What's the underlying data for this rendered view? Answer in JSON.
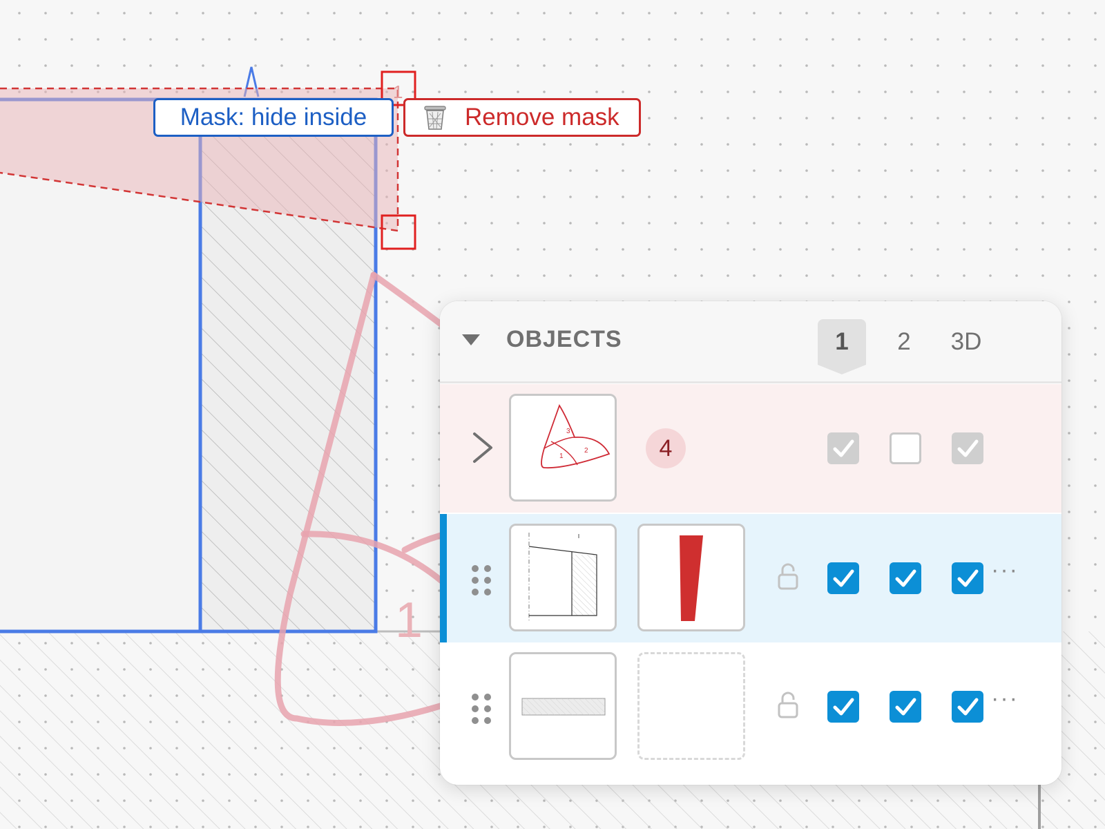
{
  "canvas": {
    "dimension_label": "1",
    "handle_label": "1"
  },
  "mask_toolbar": {
    "mask_mode_label": "Mask: hide inside",
    "remove_label": "Remove mask"
  },
  "panel": {
    "title": "OBJECTS",
    "view_tabs": [
      {
        "label": "1",
        "active": true
      },
      {
        "label": "2",
        "active": false
      },
      {
        "label": "3D",
        "active": false
      }
    ],
    "rows": [
      {
        "type": "group",
        "badge": "4",
        "thumb_labels": [
          "1",
          "2",
          "3"
        ],
        "views": [
          "disabled-checked",
          "unchecked",
          "disabled-checked"
        ]
      },
      {
        "type": "object",
        "selected": true,
        "locked": false,
        "views": [
          "checked",
          "checked",
          "checked"
        ],
        "more_label": "···"
      },
      {
        "type": "object",
        "selected": false,
        "locked": false,
        "views": [
          "checked",
          "checked",
          "checked"
        ],
        "more_label": "···"
      }
    ]
  },
  "colors": {
    "accent_blue": "#0c8fd6",
    "mask_red": "#cc2a2a",
    "outline_blue": "#4a7be6",
    "shape_pink": "#e8a3ae"
  }
}
